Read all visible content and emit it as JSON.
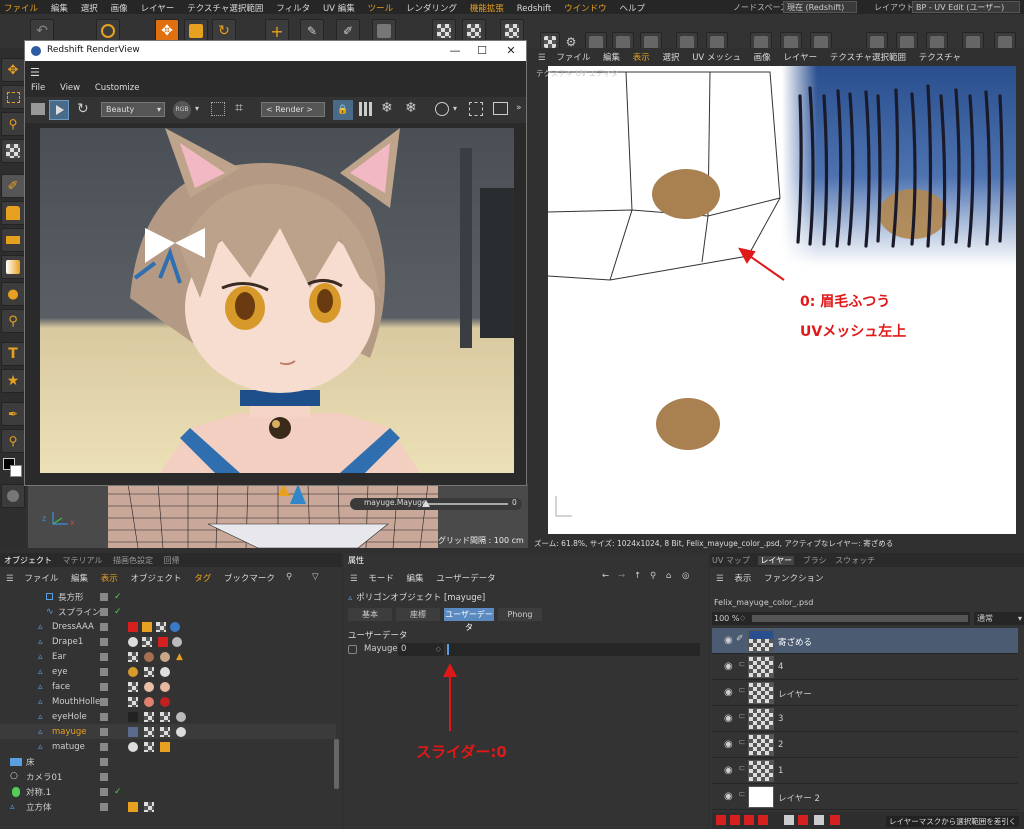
{
  "main_menu": {
    "items": [
      "ファイル",
      "編集",
      "選択",
      "画像",
      "レイヤー",
      "テクスチャ選択範囲",
      "フィルタ",
      "UV 編集",
      "ツール",
      "レンダリング",
      "機能拡張",
      "Redshift",
      "ウインドウ",
      "ヘルプ"
    ],
    "node_space_label": "ノードスペース:",
    "node_space_value": "現在 (Redshift)",
    "layout_label": "レイアウト:",
    "layout_value": "BP - UV Edit (ユーザー)"
  },
  "renderview": {
    "title": "Redshift RenderView",
    "menu": [
      "File",
      "View",
      "Customize"
    ],
    "aov_select": "Beauty",
    "render_select": "< Render >",
    "slider_label": "mayuge.Mayuge",
    "slider_value": "0",
    "grid_label": "グリッド間隔 : 100 cm"
  },
  "uv_editor": {
    "menu": [
      "ファイル",
      "編集",
      "表示",
      "選択",
      "UV メッシュ",
      "画像",
      "レイヤー",
      "テクスチャ選択範囲",
      "テクスチャ"
    ],
    "panel_label": "テクスチャ UV エディタ",
    "annotation_line1": "0: 眉毛ふつう",
    "annotation_line2": "UVメッシュ左上",
    "status": "ズーム: 61.8%, サイズ: 1024x1024, 8 Bit, Felix_mayuge_color_.psd, アクティブなレイヤー: 寄ざめる"
  },
  "object_manager": {
    "tabs": [
      "オブジェクト",
      "マテリアル",
      "描画色設定",
      "回帰"
    ],
    "menu": [
      "ファイル",
      "編集",
      "表示",
      "オブジェクト",
      "タグ",
      "ブックマーク"
    ],
    "objects": [
      "長方形",
      "スプライン",
      "DressAAA",
      "Drape1",
      "Ear",
      "eye",
      "face",
      "MouthHolle",
      "eyeHole",
      "mayuge",
      "matuge",
      "床",
      "カメラ01",
      "対称.1",
      "立方体"
    ]
  },
  "attributes": {
    "tab": "属性",
    "menu": [
      "モード",
      "編集",
      "ユーザーデータ"
    ],
    "object_title": "ポリゴンオブジェクト [mayuge]",
    "tabs": [
      "基本",
      "座標",
      "ユーザーデータ",
      "Phong"
    ],
    "section": "ユーザーデータ",
    "field_label": "Mayuge",
    "field_value": "0",
    "annotation": "スライダー:0"
  },
  "layers": {
    "tabs": [
      "UV マップ",
      "レイヤー",
      "ブラシ",
      "スウォッチ"
    ],
    "menu": [
      "表示",
      "ファンクション"
    ],
    "file": "Felix_mayuge_color_.psd",
    "opacity": "100 %",
    "blend": "通常",
    "items": [
      "寄ざめる",
      "4",
      "レイヤー",
      "3",
      "2",
      "1",
      "レイヤー 2"
    ],
    "tooltip": "レイヤーマスクから選択範囲を差引く"
  }
}
